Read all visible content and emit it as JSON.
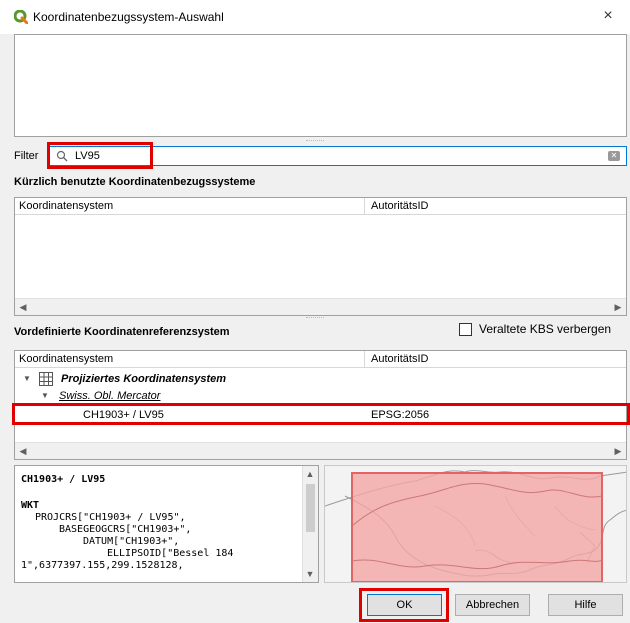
{
  "window": {
    "title": "Koordinatenbezugssystem-Auswahl",
    "close_glyph": "×"
  },
  "filter": {
    "label": "Filter",
    "value": "LV95",
    "icon": "search-icon"
  },
  "recent": {
    "heading": "Kürzlich benutzte Koordinatenbezugssysteme",
    "columns": [
      "Koordinatensystem",
      "AutoritätsID"
    ],
    "rows": []
  },
  "predefined": {
    "heading": "Vordefinierte Koordinatenreferenzsystem",
    "hide_deprecated_label": "Veraltete KBS verbergen",
    "hide_deprecated_checked": false,
    "columns": [
      "Koordinatensystem",
      "AutoritätsID"
    ],
    "tree": {
      "group_label": "Projiziertes Koordinatensystem",
      "subgroup_label": "Swiss. Obl. Mercator",
      "item": {
        "name": "CH1903+ / LV95",
        "authority_id": "EPSG:2056"
      }
    }
  },
  "details": {
    "title": "CH1903+ / LV95",
    "wkt_label": "WKT",
    "wkt_lines": [
      "PROJCRS[\"CH1903+ / LV95\",",
      "BASEGEOGCRS[\"CH1903+\",",
      "DATUM[\"CH1903+\",",
      "ELLIPSOID[\"Bessel 184",
      "1\",6377397.155,299.1528128,"
    ]
  },
  "buttons": {
    "ok": "OK",
    "cancel": "Abbrechen",
    "help": "Hilfe"
  },
  "colors": {
    "highlight": "#e00000",
    "extent_fill": "#f4a6a4",
    "extent_stroke": "#e06666",
    "focus": "#0078d7"
  }
}
